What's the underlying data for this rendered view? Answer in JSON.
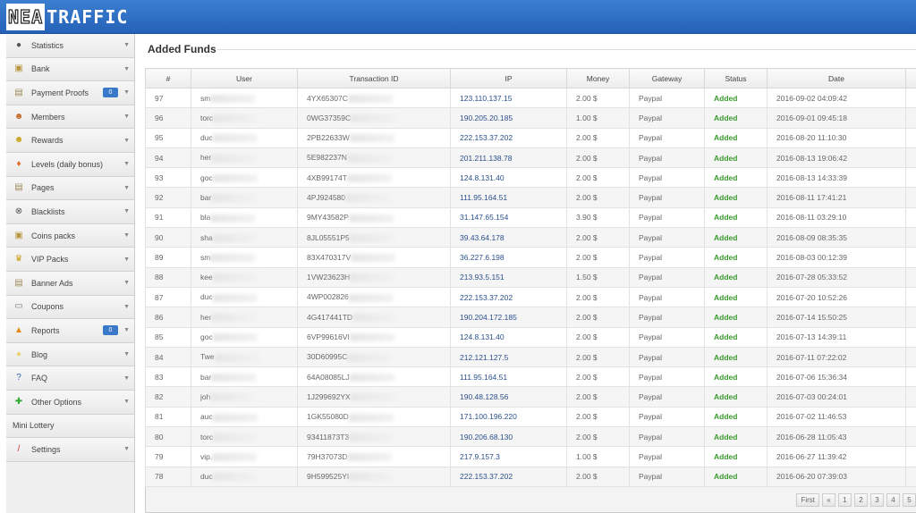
{
  "header": {
    "logo_a": "NEA",
    "logo_b": "TRAFFIC",
    "brand_color": "#2f6fc4"
  },
  "sidebar": {
    "items": [
      {
        "label": "Statistics",
        "icon": "dashboard-icon",
        "glyph": "●",
        "color": "#555"
      },
      {
        "label": "Bank",
        "icon": "bank-icon",
        "glyph": "▣",
        "color": "#b8963e"
      },
      {
        "label": "Payment Proofs",
        "icon": "document-icon",
        "glyph": "▤",
        "color": "#a08a5a",
        "badge": "0"
      },
      {
        "label": "Members",
        "icon": "users-icon",
        "glyph": "☻",
        "color": "#c46a2a"
      },
      {
        "label": "Rewards",
        "icon": "medal-icon",
        "glyph": "☻",
        "color": "#c9a21c"
      },
      {
        "label": "Levels (daily bonus)",
        "icon": "ribbon-icon",
        "glyph": "♦",
        "color": "#e06b2a"
      },
      {
        "label": "Pages",
        "icon": "pages-icon",
        "glyph": "▤",
        "color": "#a08a5a"
      },
      {
        "label": "Blacklists",
        "icon": "block-icon",
        "glyph": "⊗",
        "color": "#555"
      },
      {
        "label": "Coins packs",
        "icon": "coins-icon",
        "glyph": "▣",
        "color": "#b8963e"
      },
      {
        "label": "VIP Packs",
        "icon": "vip-icon",
        "glyph": "♛",
        "color": "#c9a21c"
      },
      {
        "label": "Banner Ads",
        "icon": "banner-icon",
        "glyph": "▤",
        "color": "#a08a5a"
      },
      {
        "label": "Coupons",
        "icon": "coupon-icon",
        "glyph": "▭",
        "color": "#777"
      },
      {
        "label": "Reports",
        "icon": "warning-icon",
        "glyph": "▲",
        "color": "#e08a10",
        "badge": "0"
      },
      {
        "label": "Blog",
        "icon": "chat-icon",
        "glyph": "●",
        "color": "#e8d070"
      },
      {
        "label": "FAQ",
        "icon": "help-icon",
        "glyph": "?",
        "color": "#2e5cb8"
      },
      {
        "label": "Other Options",
        "icon": "plus-icon",
        "glyph": "✚",
        "color": "#2ea82e"
      },
      {
        "label": "Mini Lottery",
        "plain": true
      },
      {
        "label": "Settings",
        "icon": "brush-icon",
        "glyph": "/",
        "color": "#c8302e"
      }
    ]
  },
  "main": {
    "title": "Added Funds",
    "columns": [
      "#",
      "User",
      "Transaction ID",
      "IP",
      "Money",
      "Gateway",
      "Status",
      "Date"
    ],
    "rows": [
      [
        "97",
        "sm",
        "4YX65307C",
        "123.110.137.15",
        "2.00 $",
        "Paypal",
        "Added",
        "2016-09-02 04:09:42"
      ],
      [
        "96",
        "torc",
        "0WG37359C",
        "190.205.20.185",
        "1.00 $",
        "Paypal",
        "Added",
        "2016-09-01 09:45:18"
      ],
      [
        "95",
        "duc",
        "2PB22633W",
        "222.153.37.202",
        "2.00 $",
        "Paypal",
        "Added",
        "2016-08-20 11:10:30"
      ],
      [
        "94",
        "her",
        "5E982237N",
        "201.211.138.78",
        "2.00 $",
        "Paypal",
        "Added",
        "2016-08-13 19:06:42"
      ],
      [
        "93",
        "goc",
        "4XB99174T",
        "124.8.131.40",
        "2.00 $",
        "Paypal",
        "Added",
        "2016-08-13 14:33:39"
      ],
      [
        "92",
        "bar",
        "4PJ924580",
        "111.95.164.51",
        "2.00 $",
        "Paypal",
        "Added",
        "2016-08-11 17:41:21"
      ],
      [
        "91",
        "bla",
        "9MY43582P",
        "31.147.65.154",
        "3.90 $",
        "Paypal",
        "Added",
        "2016-08-11 03:29:10"
      ],
      [
        "90",
        "sha",
        "8JL05551P5",
        "39.43.64.178",
        "2.00 $",
        "Paypal",
        "Added",
        "2016-08-09 08:35:35"
      ],
      [
        "89",
        "sm",
        "83X470317V",
        "36.227.6.198",
        "2.00 $",
        "Paypal",
        "Added",
        "2016-08-03 00:12:39"
      ],
      [
        "88",
        "kee",
        "1VW23623H",
        "213.93.5.151",
        "1.50 $",
        "Paypal",
        "Added",
        "2016-07-28 05:33:52"
      ],
      [
        "87",
        "duc",
        "4WP002826",
        "222.153.37.202",
        "2.00 $",
        "Paypal",
        "Added",
        "2016-07-20 10:52:26"
      ],
      [
        "86",
        "her",
        "4G417441TD",
        "190.204.172.185",
        "2.00 $",
        "Paypal",
        "Added",
        "2016-07-14 15:50:25"
      ],
      [
        "85",
        "goc",
        "6VP99616VI",
        "124.8.131.40",
        "2.00 $",
        "Paypal",
        "Added",
        "2016-07-13 14:39:11"
      ],
      [
        "84",
        "Twe",
        "30D60995C",
        "212.121.127.5",
        "2.00 $",
        "Paypal",
        "Added",
        "2016-07-11 07:22:02"
      ],
      [
        "83",
        "bar",
        "64A08085LJ",
        "111.95.164.51",
        "2.00 $",
        "Paypal",
        "Added",
        "2016-07-06 15:36:34"
      ],
      [
        "82",
        "joh",
        "1J299692YX",
        "190.48.128.56",
        "2.00 $",
        "Paypal",
        "Added",
        "2016-07-03 00:24:01"
      ],
      [
        "81",
        "auc",
        "1GK55080D",
        "171.100.196.220",
        "2.00 $",
        "Paypal",
        "Added",
        "2016-07-02 11:46:53"
      ],
      [
        "80",
        "torc",
        "93411873T3",
        "190.206.68.130",
        "2.00 $",
        "Paypal",
        "Added",
        "2016-06-28 11:05:43"
      ],
      [
        "79",
        "vip.",
        "79H37073D",
        "217.9.157.3",
        "1.00 $",
        "Paypal",
        "Added",
        "2016-06-27 11:39:42"
      ],
      [
        "78",
        "duc",
        "9H599525YI",
        "222.153.37.202",
        "2.00 $",
        "Paypal",
        "Added",
        "2016-06-20 07:39:03"
      ]
    ],
    "status_color": "#3a9a2e",
    "pagination": [
      "First",
      "«",
      "1",
      "2",
      "3",
      "4",
      "5"
    ]
  }
}
